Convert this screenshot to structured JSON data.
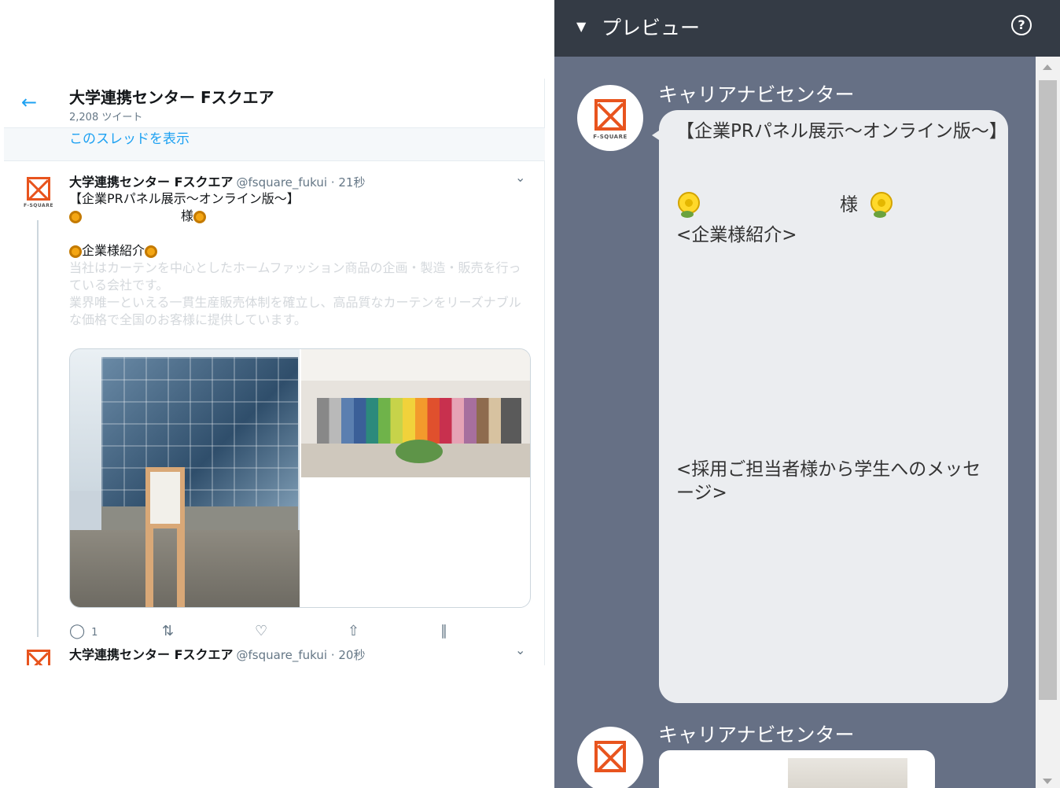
{
  "twitter": {
    "account_name": "大学連携センター Fスクエア",
    "tweet_count": "2,208 ツイート",
    "back_icon": "arrow-left-icon",
    "show_thread": "このスレッドを表示",
    "tweets": [
      {
        "name": "大学連携センター Fスクエア",
        "handle_time": "@fsquare_fukui · 21秒",
        "line1": "【企業PRパネル展示〜オンライン版〜】",
        "line2": "様",
        "line3": "企業様紹介",
        "desc1": "当社はカーテンを中心としたホームファッション商品の企画・製造・販売を行っている会社です。",
        "desc2": "業界唯一といえる一貫生産販売体制を確立し、高品質なカーテンをリーズナブルな価格で全国のお客様に提供しています。",
        "reply_count": "1"
      },
      {
        "name": "大学連携センター Fスクエア",
        "handle_time": "@fsquare_fukui · 20秒"
      }
    ],
    "logo_caption": "F-SQUARE",
    "accent_color": "#1da1f2"
  },
  "preview": {
    "title": "プレビュー",
    "help": "?",
    "sender": "キャリアナビセンター",
    "message": {
      "title": "【企業PRパネル展示〜オンライン版〜】",
      "sama": "様",
      "intro": "<企業様紹介>",
      "recruit": "<採用ご担当者様から学生へのメッセージ>"
    },
    "logo_caption": "F-SQUARE",
    "header_color": "#343b45",
    "background_color": "#667085"
  }
}
